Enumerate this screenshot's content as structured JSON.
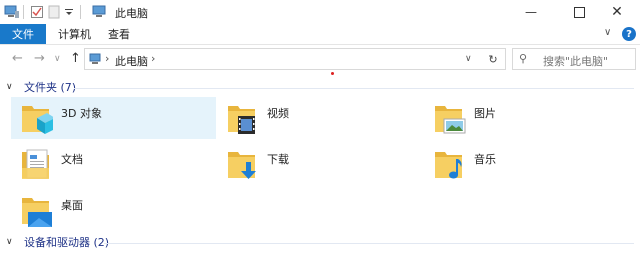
{
  "window": {
    "title": "此电脑",
    "controls": [
      "minimize",
      "maximize",
      "close"
    ]
  },
  "ribbon": {
    "tabs": [
      {
        "label": "文件",
        "active": true
      },
      {
        "label": "计算机",
        "active": false
      },
      {
        "label": "查看",
        "active": false
      }
    ],
    "help_label": "?"
  },
  "nav": {
    "address": "此电脑",
    "search_placeholder": "搜索\"此电脑\""
  },
  "groups": {
    "folders": {
      "title": "文件夹 (7)",
      "items": [
        {
          "label": "3D 对象",
          "icon": "3d-objects-icon",
          "selected": true
        },
        {
          "label": "视频",
          "icon": "videos-icon",
          "selected": false
        },
        {
          "label": "图片",
          "icon": "pictures-icon",
          "selected": false
        },
        {
          "label": "文档",
          "icon": "documents-icon",
          "selected": false
        },
        {
          "label": "下载",
          "icon": "downloads-icon",
          "selected": false
        },
        {
          "label": "音乐",
          "icon": "music-icon",
          "selected": false
        },
        {
          "label": "桌面",
          "icon": "desktop-icon",
          "selected": false
        }
      ]
    },
    "devices": {
      "title": "设备和驱动器 (2)"
    }
  },
  "colors": {
    "accent": "#1979ca",
    "group_header": "#1e3287",
    "selection": "#e5f3fb",
    "folder": "#f3c553"
  }
}
